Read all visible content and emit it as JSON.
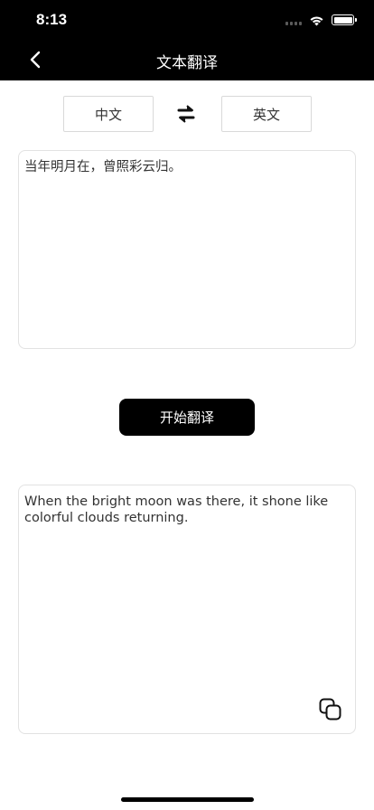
{
  "status_bar": {
    "time": "8:13"
  },
  "nav": {
    "title": "文本翻译"
  },
  "languages": {
    "source": "中文",
    "target": "英文"
  },
  "source_text": "当年明月在，曾照彩云归。",
  "translate_button": "开始翻译",
  "result_text": "When the bright moon was there, it shone like colorful clouds returning.",
  "icons": {
    "back": "chevron-left-icon",
    "swap": "swap-arrows-icon",
    "copy": "copy-icon",
    "wifi": "wifi-icon",
    "battery": "battery-icon",
    "signal": "signal-icon"
  },
  "colors": {
    "header_bg": "#000000",
    "button_bg": "#000000",
    "border": "#e2e2e2"
  }
}
